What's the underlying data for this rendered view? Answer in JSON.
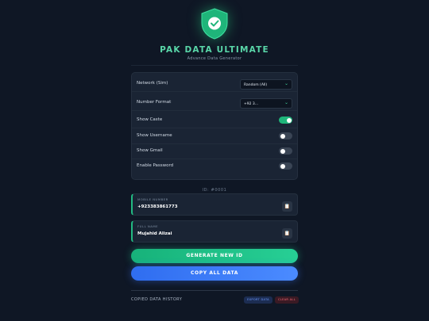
{
  "colors": {
    "accent_green": "#22b982",
    "accent_blue": "#3b7bff",
    "accent_red": "#ff6b7a",
    "background": "#0f1725"
  },
  "header": {
    "logo_icon": "shield-check-icon",
    "title": "PAK DATA ULTIMATE",
    "subtitle": "Advance Data Generator"
  },
  "settings": {
    "network": {
      "label": "Network (Sim)",
      "value": "Random (All)"
    },
    "number_format": {
      "label": "Number Format",
      "value": "+92 3..."
    },
    "toggles": [
      {
        "label": "Show Caste",
        "on": true
      },
      {
        "label": "Show Username",
        "on": false
      },
      {
        "label": "Show Gmail",
        "on": false
      },
      {
        "label": "Enable Password",
        "on": false
      }
    ]
  },
  "record": {
    "id_text": "ID: #0001",
    "fields": [
      {
        "label": "MOBILE NUMBER",
        "value": "+923383861773",
        "copy_icon": "clipboard-icon"
      },
      {
        "label": "FULL NAME",
        "value": "Mujahid Alizai",
        "copy_icon": "clipboard-icon"
      }
    ]
  },
  "actions": {
    "generate_label": "GENERATE NEW ID",
    "copy_all_label": "COPY ALL DATA"
  },
  "history": {
    "title": "COPIED DATA HISTORY",
    "export_label": "EXPORT DATA",
    "clear_label": "CLEAR ALL"
  }
}
